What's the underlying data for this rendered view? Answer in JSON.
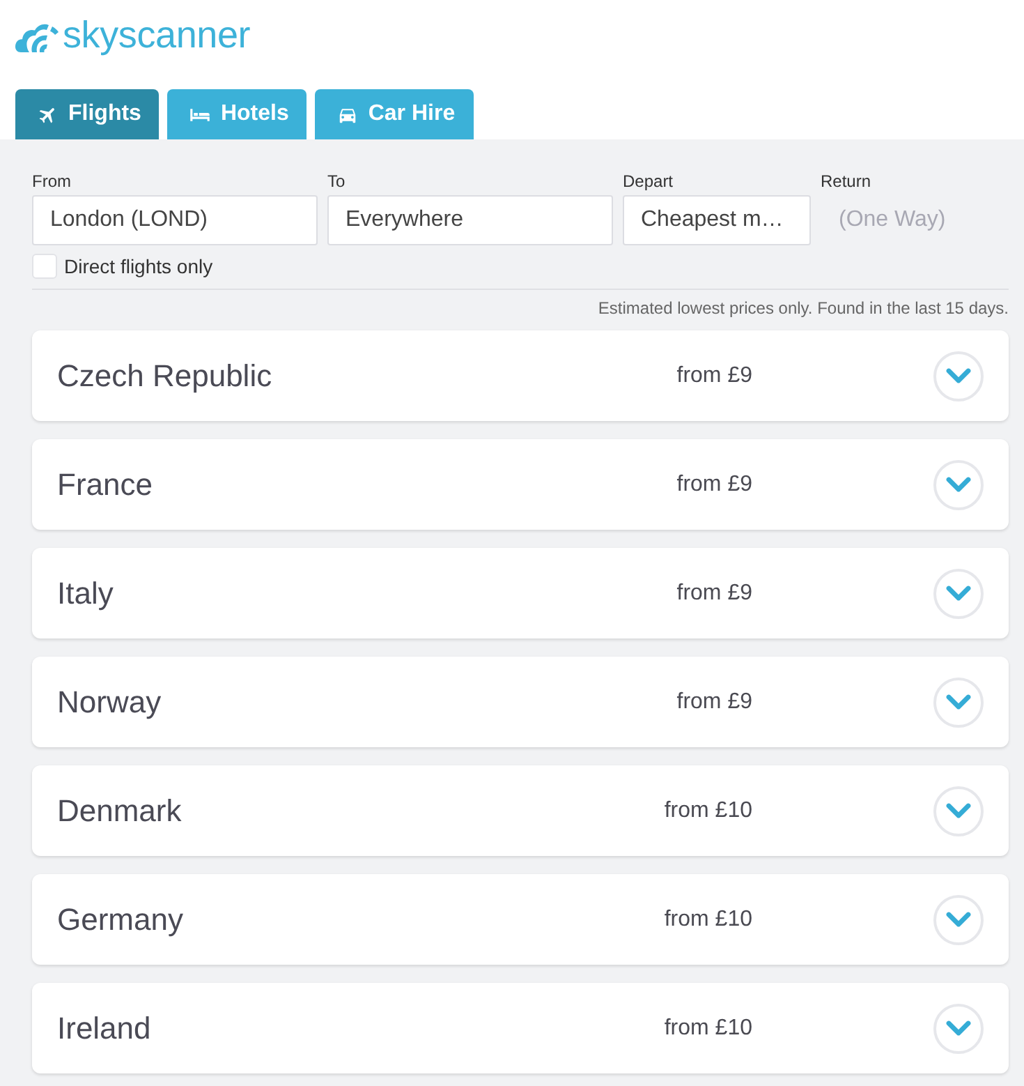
{
  "logo": {
    "text": "skyscanner"
  },
  "tabs": [
    {
      "label": "Flights",
      "selected": true
    },
    {
      "label": "Hotels",
      "selected": false
    },
    {
      "label": "Car Hire",
      "selected": false
    }
  ],
  "search": {
    "fields": [
      {
        "label": "From",
        "value": "London (LOND)",
        "disabled": false
      },
      {
        "label": "To",
        "value": "Everywhere",
        "disabled": false
      },
      {
        "label": "Depart",
        "value": "Cheapest m…",
        "disabled": false
      },
      {
        "label": "Return",
        "placeholder": "(One Way)",
        "disabled": true
      }
    ],
    "direct_flights": {
      "label": "Direct flights only",
      "checked": false
    }
  },
  "note": "Estimated lowest prices only. Found in the last 15 days.",
  "results": [
    {
      "country": "Czech Republic",
      "price": "from £9",
      "expanded": false
    },
    {
      "country": "France",
      "price": "from £9",
      "expanded": false
    },
    {
      "country": "Italy",
      "price": "from £9",
      "expanded": false
    },
    {
      "country": "Norway",
      "price": "from £9",
      "expanded": false
    },
    {
      "country": "Denmark",
      "price": "from £10",
      "expanded": false
    },
    {
      "country": "Germany",
      "price": "from £10",
      "expanded": false
    },
    {
      "country": "Ireland",
      "price": "from £10",
      "expanded": false
    }
  ]
}
